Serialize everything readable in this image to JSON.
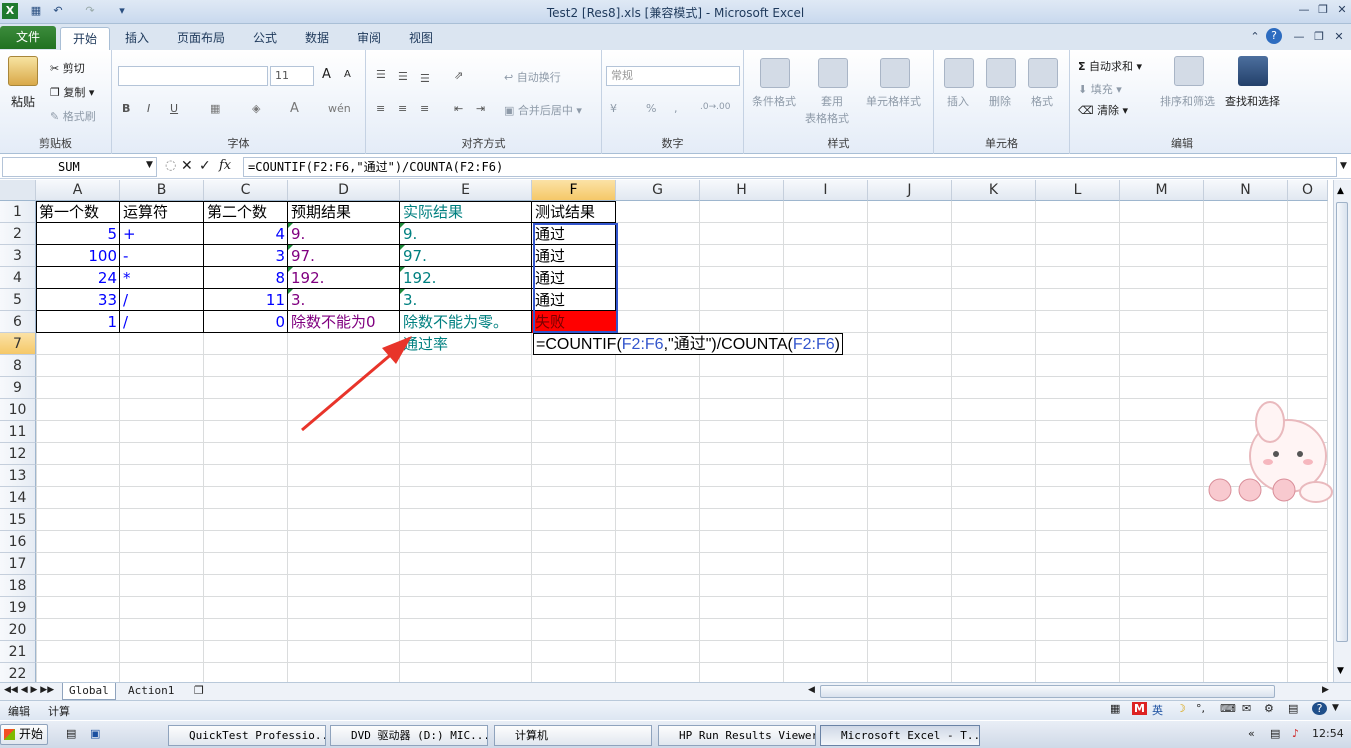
{
  "window": {
    "title": "Test2 [Res8].xls  [兼容模式] - Microsoft Excel"
  },
  "ribbon_tabs": [
    "文件",
    "开始",
    "插入",
    "页面布局",
    "公式",
    "数据",
    "审阅",
    "视图"
  ],
  "ribbon": {
    "clipboard": {
      "paste": "粘贴",
      "cut": "剪切",
      "copy": "复制",
      "format_painter": "格式刷",
      "label": "剪贴板"
    },
    "font": {
      "font_size": "11",
      "bold": "B",
      "italic": "I",
      "underline": "U",
      "grow": "A",
      "shrink": "A",
      "wen": "wén",
      "label": "字体"
    },
    "alignment": {
      "wrap": "自动换行",
      "merge": "合并后居中",
      "label": "对齐方式"
    },
    "number": {
      "format": "常规",
      "percent": "%",
      "comma": ",",
      "label": "数字"
    },
    "styles": {
      "conditional": "条件格式",
      "table1": "套用",
      "table2": "表格格式",
      "cell_styles": "单元格样式",
      "label": "样式"
    },
    "cells": {
      "insert": "插入",
      "delete": "删除",
      "format": "格式",
      "label": "单元格"
    },
    "editing": {
      "autosum": "自动求和",
      "fill": "填充",
      "clear": "清除",
      "sort": "排序和筛选",
      "find": "查找和选择",
      "label": "编辑"
    }
  },
  "formula_bar": {
    "name_box": "SUM",
    "fx": "fx",
    "formula": "=COUNTIF(F2:F6,\"通过\")/COUNTA(F2:F6)"
  },
  "columns": [
    "A",
    "B",
    "C",
    "D",
    "E",
    "F",
    "G",
    "H",
    "I",
    "J",
    "K",
    "L",
    "M",
    "N",
    "O"
  ],
  "rows": [
    "1",
    "2",
    "3",
    "4",
    "5",
    "6",
    "7",
    "8",
    "9",
    "10",
    "11",
    "12",
    "13",
    "14",
    "15",
    "16",
    "17",
    "18",
    "19",
    "20",
    "21",
    "22"
  ],
  "cells": {
    "A1": "第一个数",
    "B1": "运算符",
    "C1": "第二个数",
    "D1": "预期结果",
    "E1": "实际结果",
    "F1": "测试结果",
    "A2": "5",
    "B2": "+",
    "C2": "4",
    "D2": "9.",
    "E2": "9.",
    "F2": "通过",
    "A3": "100",
    "B3": "-",
    "C3": "3",
    "D3": "97.",
    "E3": "97.",
    "F3": "通过",
    "A4": "24",
    "B4": "*",
    "C4": "8",
    "D4": "192.",
    "E4": "192.",
    "F4": "通过",
    "A5": "33",
    "B5": "/",
    "C5": "11",
    "D5": "3.",
    "E5": "3.",
    "F5": "通过",
    "A6": "1",
    "B6": "/",
    "C6": "0",
    "D6": "除数不能为0",
    "E6": "除数不能为零。",
    "F6": "失败",
    "E7": "通过率"
  },
  "edit_formula": {
    "p1": "=COUNTIF(",
    "r1": "F2:F6",
    "p2": ",\"通过\")/COUNTA(",
    "r2": "F2:F6",
    "p3": ")"
  },
  "sheet_tabs": [
    "Global",
    "Action1"
  ],
  "status": {
    "mode": "编辑",
    "calc": "计算"
  },
  "taskbar": {
    "start": "开始",
    "items": [
      "QuickTest Professio...",
      "DVD 驱动器 (D:) MIC...",
      "计算机",
      "HP Run Results Viewer",
      "Microsoft Excel - T..."
    ],
    "clock": "12:54"
  },
  "colors": {
    "fail_fill": "#ff0000",
    "number_blue": "#0000ff",
    "expected_purple": "#800080",
    "actual_teal": "#008080",
    "arrow_red": "#e8342a"
  }
}
